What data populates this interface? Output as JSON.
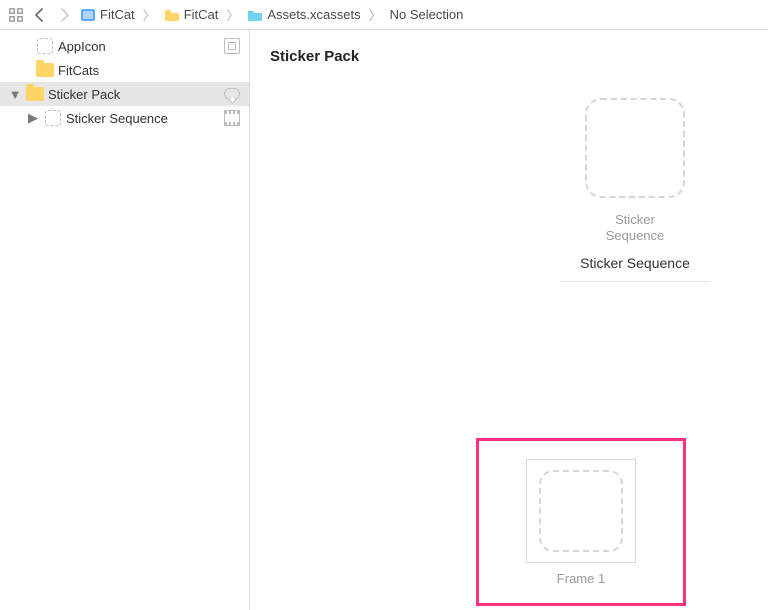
{
  "breadcrumb": {
    "items": [
      {
        "label": "FitCat",
        "icon": "project-blue"
      },
      {
        "label": "FitCat",
        "icon": "folder-yellow"
      },
      {
        "label": "Assets.xcassets",
        "icon": "assets-cyan"
      },
      {
        "label": "No Selection",
        "icon": "none"
      }
    ]
  },
  "sidebar": {
    "items": [
      {
        "label": "AppIcon",
        "icon": "dashed",
        "right": "lib",
        "indent": 0,
        "selected": false
      },
      {
        "label": "FitCats",
        "icon": "folder",
        "right": "",
        "indent": 0,
        "selected": false
      },
      {
        "label": "Sticker Pack",
        "icon": "folder",
        "right": "bubble",
        "indent": 1,
        "selected": true,
        "disclosure": "down"
      },
      {
        "label": "Sticker Sequence",
        "icon": "dashed",
        "right": "film",
        "indent": 2,
        "selected": false,
        "disclosure": "right"
      }
    ]
  },
  "content": {
    "section_title": "Sticker Pack",
    "asset": {
      "type_line1": "Sticker",
      "type_line2": "Sequence",
      "name": "Sticker Sequence"
    },
    "frame": {
      "label": "Frame 1"
    }
  }
}
